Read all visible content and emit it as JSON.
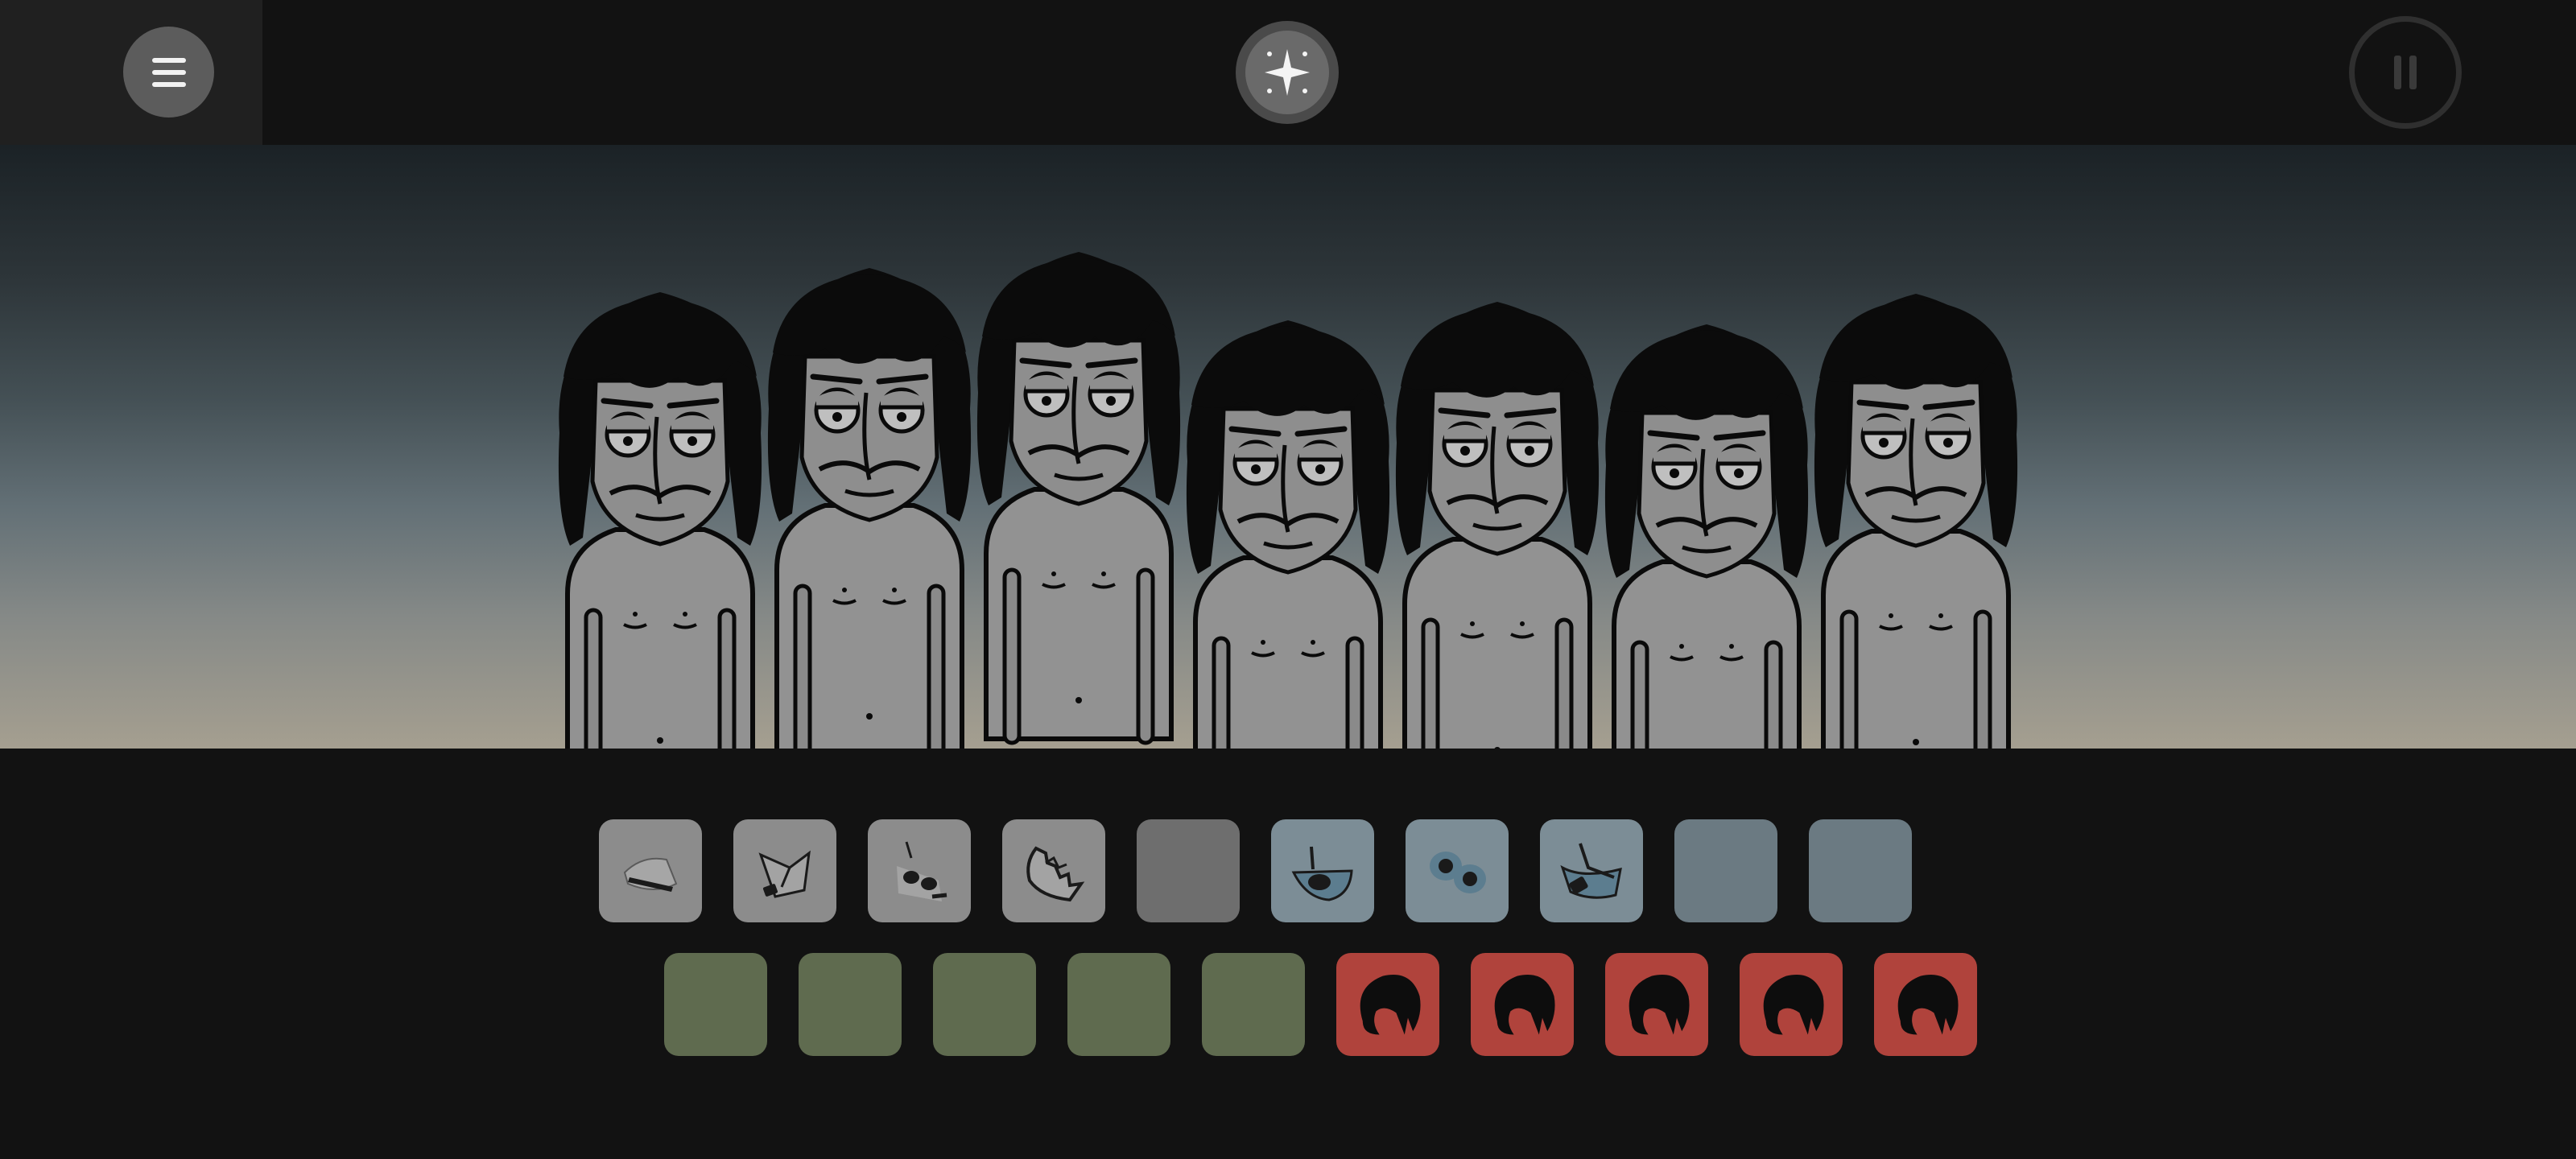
{
  "top_bar": {
    "menu_icon": "hamburger-menu-icon",
    "bonus_icon": "sparkle-icon",
    "pause_icon": "pause-icon"
  },
  "stage": {
    "characters": [
      {
        "id": 1,
        "state": "idle",
        "eyes": "half-closed"
      },
      {
        "id": 2,
        "state": "idle",
        "eyes": "half-closed"
      },
      {
        "id": 3,
        "state": "idle",
        "eyes": "half-closed"
      },
      {
        "id": 4,
        "state": "idle",
        "eyes": "closed"
      },
      {
        "id": 5,
        "state": "idle",
        "eyes": "half-closed"
      },
      {
        "id": 6,
        "state": "idle",
        "eyes": "half-closed"
      },
      {
        "id": 7,
        "state": "idle",
        "eyes": "half-closed"
      }
    ]
  },
  "palette": {
    "row1": [
      {
        "icon": "hat-icon",
        "category": "beats",
        "color": "#8c8c8c",
        "available": true
      },
      {
        "icon": "bandana-icon",
        "category": "beats",
        "color": "#8c8c8c",
        "available": true
      },
      {
        "icon": "sunglasses-icon",
        "category": "beats",
        "color": "#8c8c8c",
        "available": true
      },
      {
        "icon": "torn-mask-icon",
        "category": "beats",
        "color": "#8c8c8c",
        "available": true
      },
      {
        "icon": "empty-slot",
        "category": "beats",
        "color": "#6e6e6e",
        "available": false
      },
      {
        "icon": "eye-patch-icon",
        "category": "effects",
        "color": "#7c8d96",
        "available": true
      },
      {
        "icon": "goggles-icon",
        "category": "effects",
        "color": "#7c8d96",
        "available": true
      },
      {
        "icon": "visor-icon",
        "category": "effects",
        "color": "#7c8d96",
        "available": true
      },
      {
        "icon": "empty-slot",
        "category": "effects",
        "color": "#6b7a82",
        "available": false
      },
      {
        "icon": "empty-slot",
        "category": "effects",
        "color": "#6b7a82",
        "available": false
      }
    ],
    "row2": [
      {
        "icon": "empty-slot",
        "category": "melodies",
        "color": "#5f6b4f",
        "available": false
      },
      {
        "icon": "empty-slot",
        "category": "melodies",
        "color": "#5f6b4f",
        "available": false
      },
      {
        "icon": "empty-slot",
        "category": "melodies",
        "color": "#5f6b4f",
        "available": false
      },
      {
        "icon": "empty-slot",
        "category": "melodies",
        "color": "#5f6b4f",
        "available": false
      },
      {
        "icon": "empty-slot",
        "category": "melodies",
        "color": "#5f6b4f",
        "available": false
      },
      {
        "icon": "hair-icon",
        "category": "voices",
        "color": "#b0433c",
        "available": true
      },
      {
        "icon": "hair-icon",
        "category": "voices",
        "color": "#b0433c",
        "available": true
      },
      {
        "icon": "hair-icon",
        "category": "voices",
        "color": "#b0433c",
        "available": true
      },
      {
        "icon": "hair-icon",
        "category": "voices",
        "color": "#b0433c",
        "available": true
      },
      {
        "icon": "hair-icon",
        "category": "voices",
        "color": "#b0433c",
        "available": true
      }
    ]
  }
}
